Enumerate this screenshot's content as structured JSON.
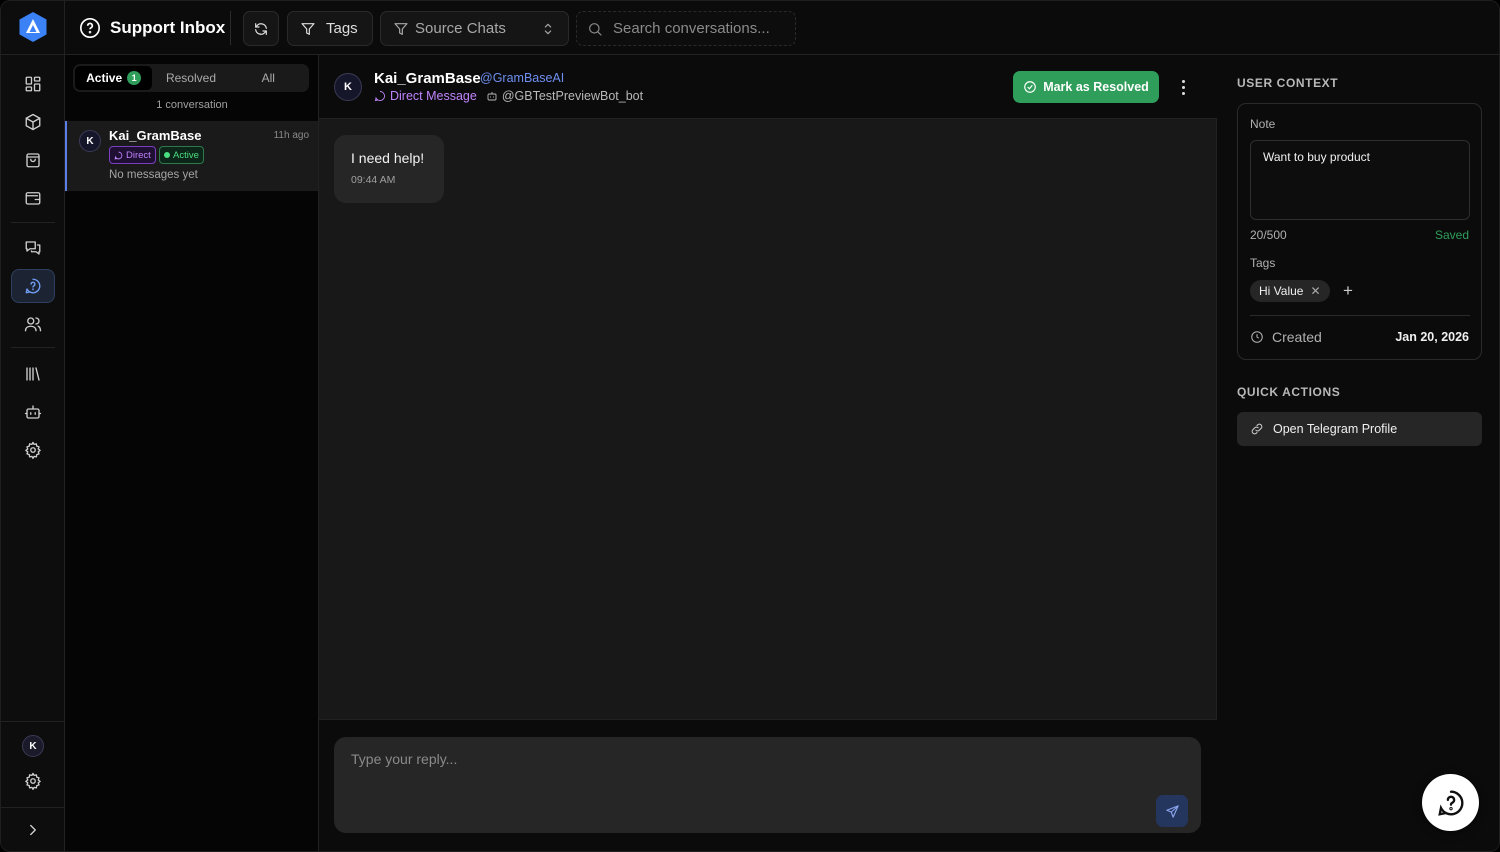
{
  "app": {
    "title": "Support Inbox",
    "accent": "#5b7ee8",
    "success": "#2f9e5b",
    "avatar_initial": "K"
  },
  "toolbar": {
    "tags_label": "Tags",
    "source_label": "Source Chats",
    "search_placeholder": "Search conversations..."
  },
  "list": {
    "tabs": [
      {
        "label": "Active",
        "count": "1",
        "selected": true
      },
      {
        "label": "Resolved"
      },
      {
        "label": "All"
      }
    ],
    "count_text": "1 conversation",
    "items": [
      {
        "initial": "K",
        "name": "Kai_GramBase",
        "time": "11h ago",
        "type_chip": "Direct",
        "status_chip": "Active",
        "preview": "No messages yet"
      }
    ]
  },
  "chat": {
    "initial": "K",
    "name": "Kai_GramBase",
    "handle": "@GramBaseAI",
    "type": "Direct Message",
    "bot": "@GBTestPreviewBot_bot",
    "resolve_label": "Mark as Resolved",
    "messages": [
      {
        "text": "I need help!",
        "time": "09:44 AM"
      }
    ],
    "reply_placeholder": "Type your reply..."
  },
  "context": {
    "heading": "USER CONTEXT",
    "note_label": "Note",
    "note_value": "Want to buy product",
    "note_count": "20/500",
    "note_status": "Saved",
    "tags_label": "Tags",
    "tags": [
      "Hi Value"
    ],
    "created_label": "Created",
    "created_date": "Jan 20, 2026",
    "quick_actions_heading": "QUICK ACTIONS",
    "quick_actions": [
      "Open Telegram Profile"
    ]
  }
}
